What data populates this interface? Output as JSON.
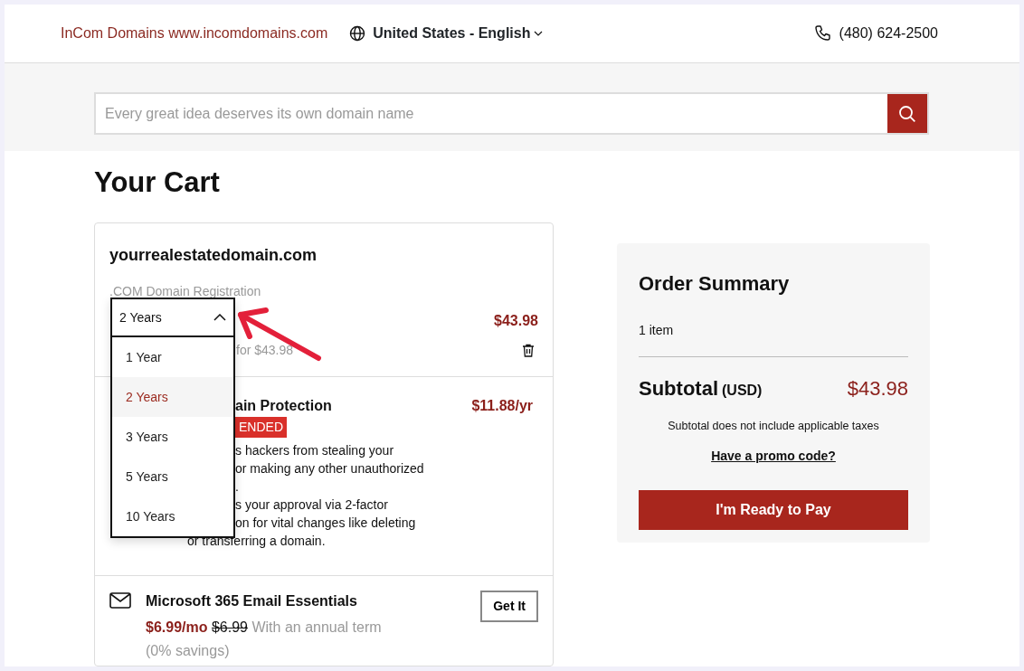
{
  "header": {
    "brand": "InCom Domains www.incomdomains.com",
    "locale": "United States - English",
    "phone": "(480) 624-2500"
  },
  "search": {
    "placeholder": "Every great idea deserves its own domain name"
  },
  "page_title": "Your Cart",
  "cart": {
    "domain": {
      "name": "yourrealestatedomain.com",
      "product": ".COM Domain Registration",
      "price": "$43.98",
      "renewal": "for $43.98",
      "term": {
        "value": "2 Years",
        "expanded": true,
        "options": [
          {
            "label": "1 Year",
            "selected": false
          },
          {
            "label": "2 Years",
            "selected": true
          },
          {
            "label": "3 Years",
            "selected": false
          },
          {
            "label": "5 Years",
            "selected": false
          },
          {
            "label": "10 Years",
            "selected": false
          }
        ]
      }
    },
    "protection": {
      "title": "ain Protection",
      "badge": "ENDED",
      "price": "$11.88/yr",
      "lines": [
        "s hackers from stealing your",
        "or making any other unauthorized",
        ".",
        "s your approval via 2-factor",
        "on for vital changes like deleting"
      ],
      "last_line": "or transferring a domain."
    },
    "email": {
      "title": "Microsoft 365 Email Essentials",
      "price": "$6.99/mo",
      "old_price": "$6.99",
      "term": "With an annual term",
      "savings": "(0% savings)",
      "button": "Get It"
    }
  },
  "summary": {
    "title": "Order Summary",
    "count": "1 item",
    "subtotal_label": "Subtotal",
    "currency": "(USD)",
    "subtotal": "$43.98",
    "note": "Subtotal does not include applicable taxes",
    "promo": "Have a promo code?",
    "button": "I'm Ready to Pay"
  }
}
